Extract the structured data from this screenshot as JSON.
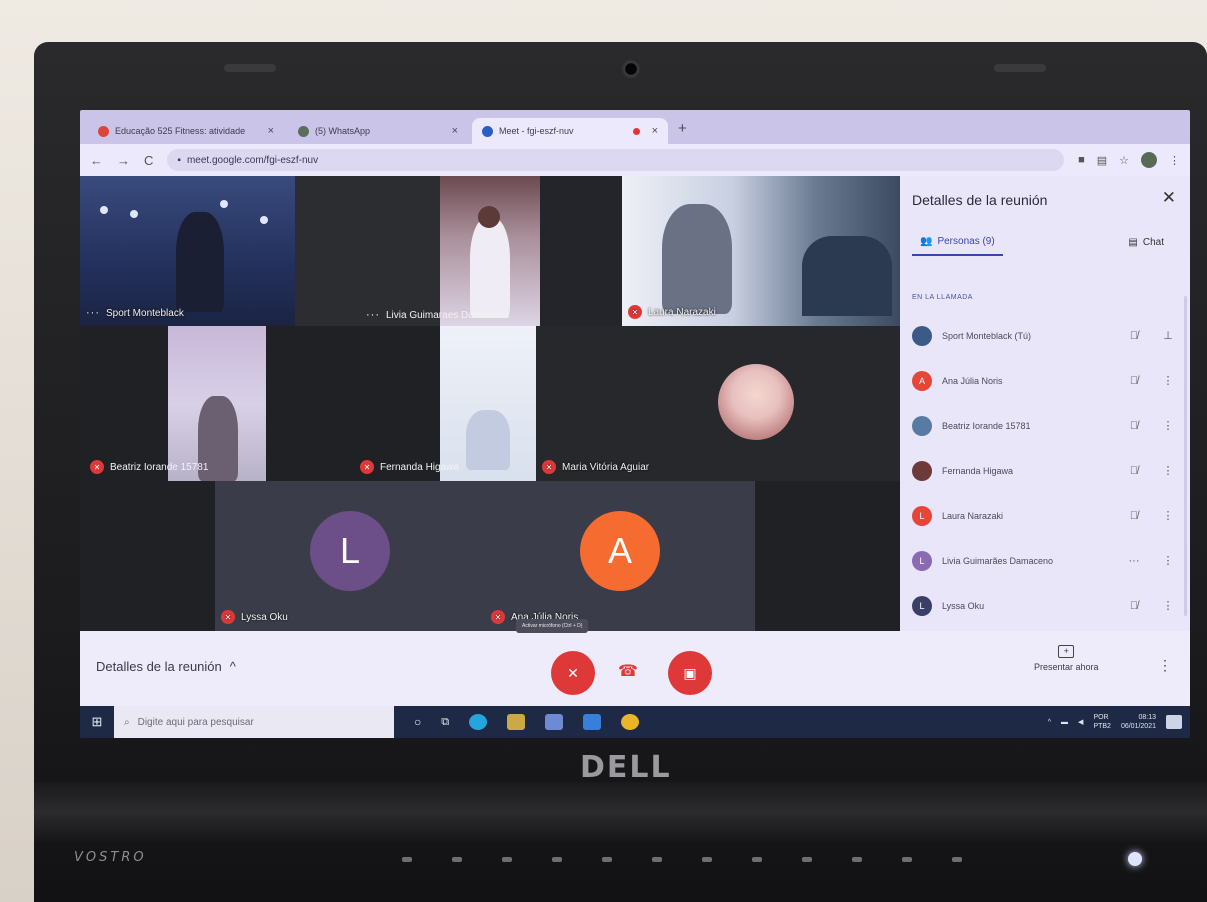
{
  "browser": {
    "tabs": [
      {
        "label": "Educação 525 Fitness: atividade",
        "fav": "#d9463b"
      },
      {
        "label": "(5) WhatsApp",
        "fav": "#5a6e5c"
      },
      {
        "label": "Meet - fgi-eszf-nuv",
        "fav": "#2b5fbf"
      }
    ],
    "url": "meet.google.com/fgi-eszf-nuv"
  },
  "tiles": [
    {
      "name": "Sport Monteblack",
      "indicator": "dots"
    },
    {
      "name": "Livia Guimaraes Damaceno",
      "indicator": "dots"
    },
    {
      "name": "Laura Narazaki",
      "indicator": "mic"
    },
    {
      "name": "Beatriz Iorande 15781",
      "indicator": "mic"
    },
    {
      "name": "Fernanda Higawa",
      "indicator": "mic"
    },
    {
      "name": "Maria Vitória Aguiar",
      "indicator": "mic"
    },
    {
      "name": "Lyssa Oku",
      "indicator": "mic",
      "avatar_letter": "L",
      "avatar_color": "#6b4f86"
    },
    {
      "name": "Ana Júlia Noris",
      "indicator": "mic",
      "avatar_letter": "A",
      "avatar_color": "#f06c34"
    }
  ],
  "panel": {
    "title": "Detalles de la reunión",
    "tab_people": "Personas (9)",
    "tab_chat": "Chat",
    "section": "EN LA LLAMADA",
    "participants": [
      {
        "name": "Sport Monteblack (Tú)",
        "letter": "",
        "color": "#3d5a86",
        "action": "pin"
      },
      {
        "name": "Ana Júlia Noris",
        "letter": "A",
        "color": "#e2473b",
        "action": "more"
      },
      {
        "name": "Beatriz Iorande 15781",
        "letter": "",
        "color": "#5a7aa0",
        "action": "more"
      },
      {
        "name": "Fernanda Higawa",
        "letter": "",
        "color": "#6b3a3a",
        "action": "more"
      },
      {
        "name": "Laura Narazaki",
        "letter": "L",
        "color": "#e2473b",
        "action": "more"
      },
      {
        "name": "Livia Guimarães Damaceno",
        "letter": "L",
        "color": "#8a6ab2",
        "action": "more"
      },
      {
        "name": "Lyssa Oku",
        "letter": "L",
        "color": "#3a3f66",
        "action": "more"
      }
    ]
  },
  "controls": {
    "details_label": "Detalles de la reunión",
    "tooltip": "Activar micrófono (Ctrl + D)",
    "present_label": "Presentar ahora"
  },
  "taskbar": {
    "search_placeholder": "Digite aqui para pesquisar",
    "lang_1": "POR",
    "lang_2": "PTB2",
    "time": "08:13",
    "date": "06/01/2021"
  },
  "brand": {
    "logo": "DELL",
    "model": "VOSTRO"
  },
  "colors": {
    "mic_off": "#d93a3a",
    "accent": "#3a46a8"
  }
}
